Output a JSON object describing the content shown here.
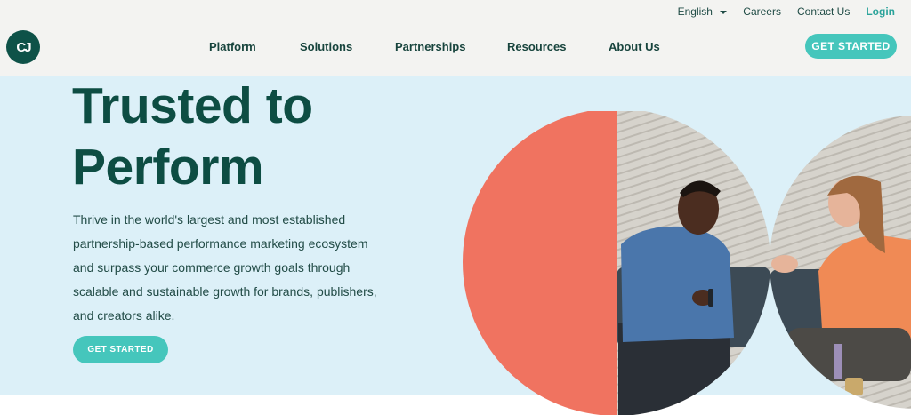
{
  "header": {
    "utility": {
      "language": "English",
      "careers": "Careers",
      "contact": "Contact Us",
      "login": "Login"
    },
    "nav": [
      {
        "label": "Platform"
      },
      {
        "label": "Solutions"
      },
      {
        "label": "Partnerships"
      },
      {
        "label": "Resources"
      },
      {
        "label": "About Us"
      }
    ],
    "cta": "GET STARTED",
    "logo_text": "CJ"
  },
  "hero": {
    "headline_line1": "Trusted to",
    "headline_line2": "Perform",
    "body_lines": [
      "Thrive in the world's largest and most established",
      "partnership-based performance marketing ecosystem",
      "and surpass your commerce growth goals through",
      "scalable and sustainable growth for brands, publishers,",
      "and creators alike."
    ],
    "cta": "GET STARTED"
  },
  "colors": {
    "brand_dark": "#0d4d43",
    "accent_teal": "#45c6bc",
    "hero_bg": "#dcf0f8",
    "coral": "#f07360"
  }
}
